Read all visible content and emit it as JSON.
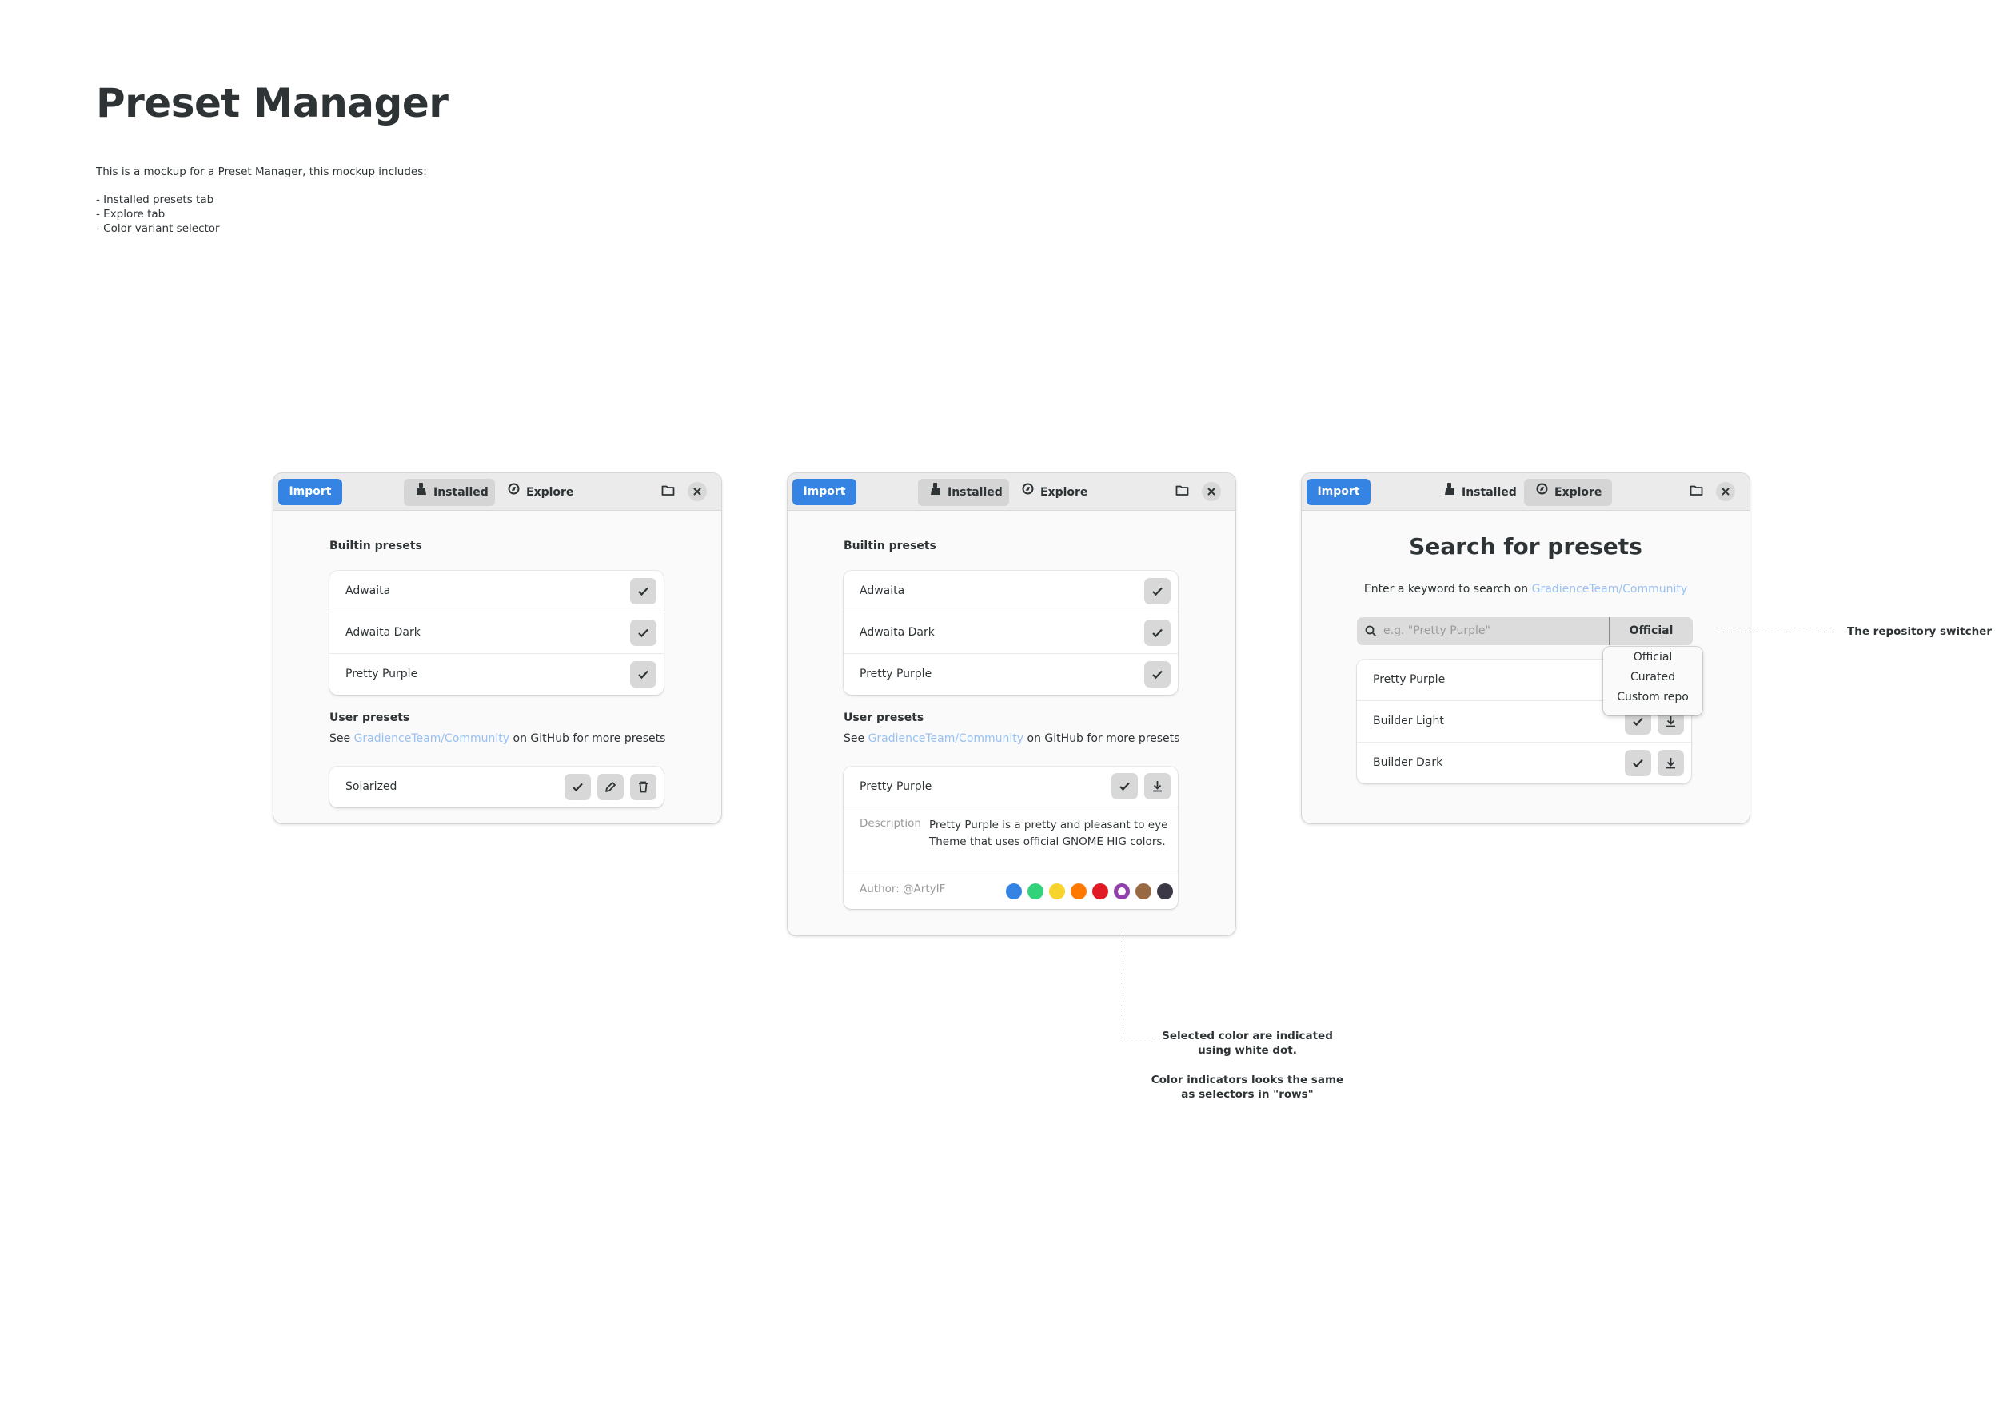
{
  "page": {
    "title": "Preset Manager",
    "intro": "This is a mockup for a Preset Manager, this mockup includes:",
    "bullets": [
      "- Installed presets tab",
      "- Explore tab",
      "- Color variant selector"
    ]
  },
  "headerbar": {
    "import_label": "Import",
    "tab_installed": "Installed",
    "tab_explore": "Explore",
    "installed_icon": "brush-icon",
    "explore_icon": "compass-icon",
    "folder_icon": "folder-icon",
    "close_icon": "close-icon",
    "accent": "#3584e4"
  },
  "installed": {
    "builtin_title": "Builtin presets",
    "builtin": [
      "Adwaita",
      "Adwaita Dark",
      "Pretty Purple"
    ],
    "user_title": "User presets",
    "see_prefix": "See ",
    "see_link": "GradienceTeam/Community",
    "see_suffix": " on GitHub for more presets",
    "user_presets": [
      "Solarized"
    ]
  },
  "expanded": {
    "name": "Pretty Purple",
    "desc_label": "Description",
    "desc_text": "Pretty Purple is a pretty and pleasant to eye Theme that uses official GNOME HIG colors.",
    "author": "Author: @ArtyIF",
    "colors": [
      "#3584e4",
      "#33d17a",
      "#f6d32d",
      "#ff7800",
      "#e01b24",
      "#9141ac",
      "#986a44",
      "#3d3846"
    ],
    "selected_color_index": 5
  },
  "explore": {
    "title": "Search for presets",
    "sub_prefix": "Enter a keyword to search on ",
    "sub_link": "GradienceTeam/Community",
    "placeholder": "e.g. \"Pretty Purple\"",
    "repo": "Official",
    "repo_options": [
      "Official",
      "Curated",
      "Custom repo"
    ],
    "results": [
      "Pretty Purple",
      "Builder Light",
      "Builder Dark"
    ]
  },
  "annotations": {
    "repo_switcher": "The repository switcher",
    "color_line1": "Selected color are indicated",
    "color_line2": "using white dot.",
    "color_line3": "Color indicators looks the same",
    "color_line4": "as selectors in \"rows\""
  }
}
